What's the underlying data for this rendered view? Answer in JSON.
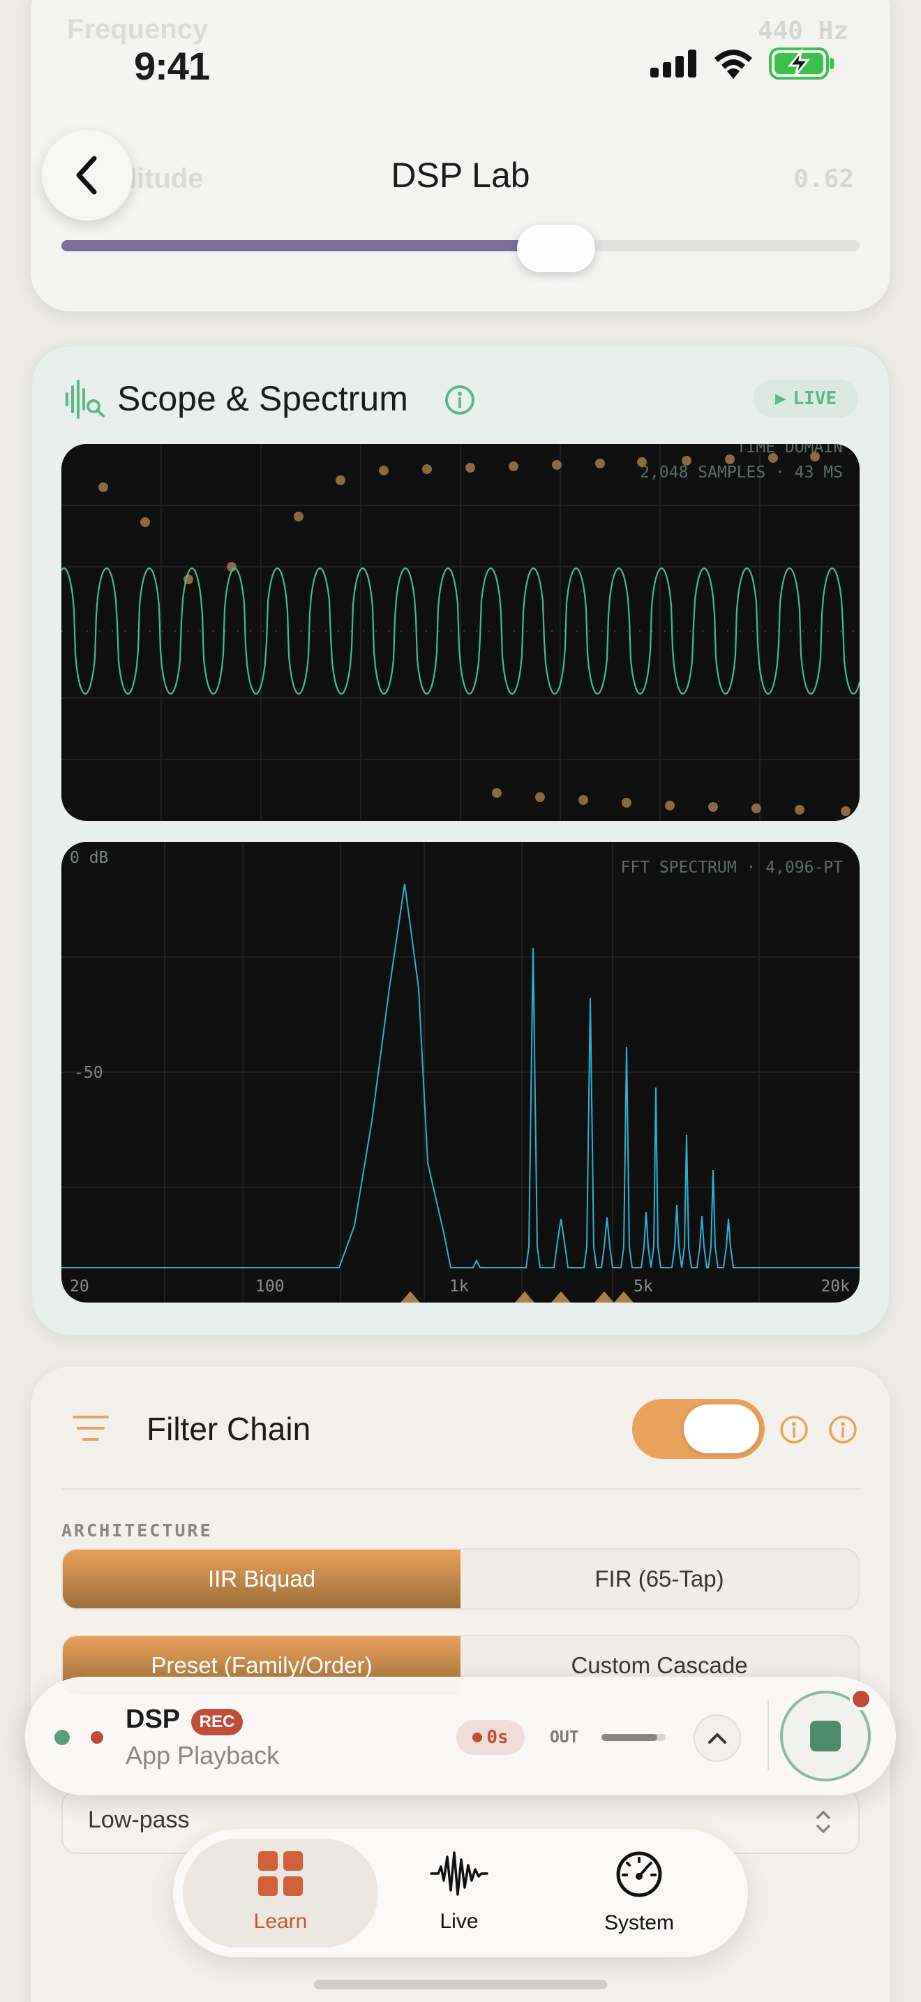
{
  "status_bar": {
    "time": "9:41"
  },
  "nav": {
    "title": "DSP Lab"
  },
  "top_card": {
    "row1_label": "Frequency",
    "row1_value": "440 Hz",
    "row2_label": "Amplitude",
    "row2_value": "0.62",
    "slider_fraction": 0.62
  },
  "scope_card": {
    "title": "Scope & Spectrum",
    "live_label": "LIVE",
    "time_domain": {
      "label": "TIME DOMAIN",
      "meta": "2,048 SAMPLES · 43 MS"
    },
    "fft": {
      "label": "FFT SPECTRUM · 4,096-PT",
      "db_top": "0 dB",
      "db_mid": "-50",
      "x_ticks": [
        "20",
        "100",
        "1k",
        "5k",
        "20k"
      ]
    }
  },
  "filter_card": {
    "title": "Filter Chain",
    "toggle_on": true,
    "architecture_label": "ARCHITECTURE",
    "arch_options": [
      "IIR Biquad",
      "FIR (65-Tap)"
    ],
    "arch_selected": "IIR Biquad",
    "mode_options": [
      "Preset (Family/Order)",
      "Custom Cascade"
    ],
    "mode_selected": "Preset (Family/Order)",
    "filter_type": "Low-pass"
  },
  "player": {
    "title": "DSP",
    "badge": "REC",
    "subtitle": "App Playback",
    "elapsed": "0s",
    "out_label": "OUT",
    "out_level": 0.87
  },
  "tabs": [
    {
      "label": "Learn",
      "icon": "grid-icon",
      "active": true
    },
    {
      "label": "Live",
      "icon": "waveform-icon",
      "active": false
    },
    {
      "label": "System",
      "icon": "gauge-icon",
      "active": false
    }
  ],
  "colors": {
    "accent_orange": "#e8a35c",
    "scope_green": "#3fbf8a",
    "fft_cyan": "#2fb0d0",
    "rec_red": "#c04c3c",
    "slider_purple": "#7c6f98"
  }
}
